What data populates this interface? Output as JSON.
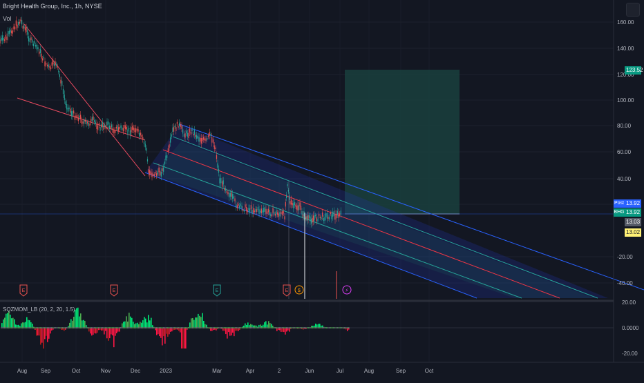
{
  "header": {
    "title": "Bright Health Group, Inc., 1h, NYSE",
    "volume_label": "Vol",
    "indicator_label": "SQZMOM_LB (20, 2, 20, 1.5)"
  },
  "price_axis": {
    "ticks": [
      "160.00",
      "140.00",
      "120.00",
      "100.00",
      "80.00",
      "60.00",
      "40.00",
      "20.00",
      "-20.00",
      "-40.00"
    ],
    "target_label": "123.52",
    "post_label": "Post",
    "post_value": "13.92",
    "symbol_label": "BHG",
    "symbol_value": "13.92",
    "last_value": "13.03",
    "alt_value": "13.02"
  },
  "indicator_axis": {
    "ticks": [
      "20.00",
      "0.0000",
      "-20.00"
    ]
  },
  "time_axis": {
    "labels": [
      "Aug",
      "Sep",
      "Oct",
      "Nov",
      "Dec",
      "2023",
      "Mar",
      "Apr",
      "2",
      "Jun",
      "Jul",
      "Aug",
      "Sep",
      "Oct"
    ]
  },
  "events": {
    "earnings_marker": "E",
    "dividend_marker": "$",
    "split_marker": "⚡"
  },
  "colors": {
    "background": "#131722",
    "up": "#26a69a",
    "down": "#ef5350",
    "channel_outer": "#2962ff",
    "channel_inner": "#26a69a",
    "channel_mid": "#f23645",
    "trendline": "#e84a5f",
    "target_zone": "#1e4d4a",
    "post_tag": "#2962ff",
    "symbol_tag": "#089981",
    "alt_tag": "#fff176"
  }
}
